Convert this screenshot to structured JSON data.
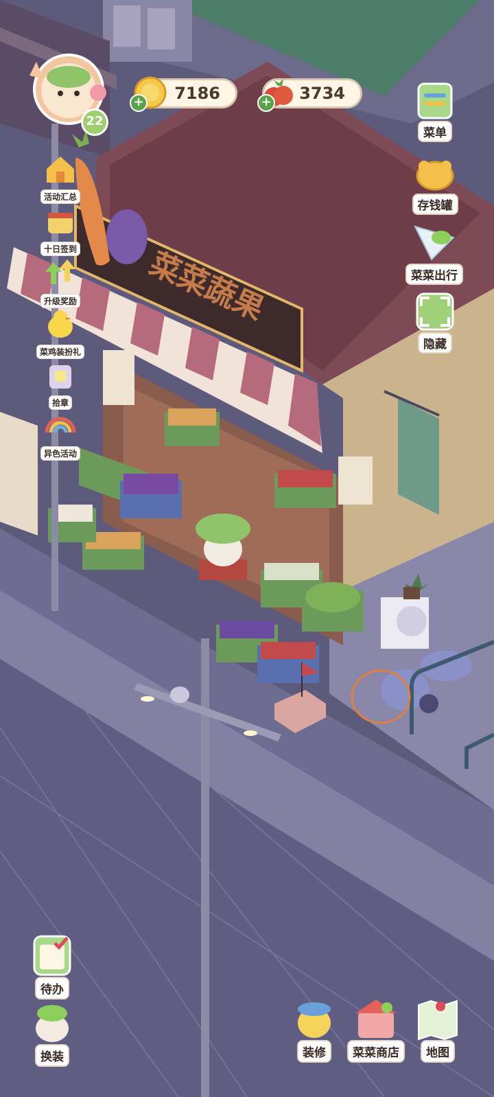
{
  "currency": {
    "coins": "7186",
    "veggies": "3734"
  },
  "player": {
    "level": "22"
  },
  "shop": {
    "sign": "菜菜蔬果"
  },
  "left_menu": [
    {
      "label": "活动汇总",
      "icon": "house-icon"
    },
    {
      "label": "十日签到",
      "icon": "calendar-pot-icon"
    },
    {
      "label": "升级奖励",
      "icon": "arrows-up-icon"
    },
    {
      "label": "菜鸡装扮礼",
      "icon": "chick-icon"
    },
    {
      "label": "拾章",
      "icon": "bag-icon"
    },
    {
      "label": "异色活动",
      "icon": "rainbow-icon"
    }
  ],
  "right_menu": [
    {
      "label": "菜单",
      "icon": "menu-board-icon"
    },
    {
      "label": "存钱罐",
      "icon": "piggy-bank-icon"
    },
    {
      "label": "菜菜出行",
      "icon": "paper-plane-icon"
    },
    {
      "label": "隐藏",
      "icon": "hide-frame-icon"
    }
  ],
  "bottom_left": [
    {
      "label": "待办",
      "icon": "todo-clipboard-icon"
    },
    {
      "label": "换装",
      "icon": "outfit-icon"
    }
  ],
  "bottom_right": [
    {
      "label": "装修",
      "icon": "decorate-icon"
    },
    {
      "label": "菜菜商店",
      "icon": "store-icon"
    },
    {
      "label": "地图",
      "icon": "map-icon"
    }
  ],
  "colors": {
    "night_street": "#5e5a7c",
    "awning_stripe": "#b56b7c",
    "roof": "#7e4a56",
    "annotation_circle": "#e0803a"
  }
}
